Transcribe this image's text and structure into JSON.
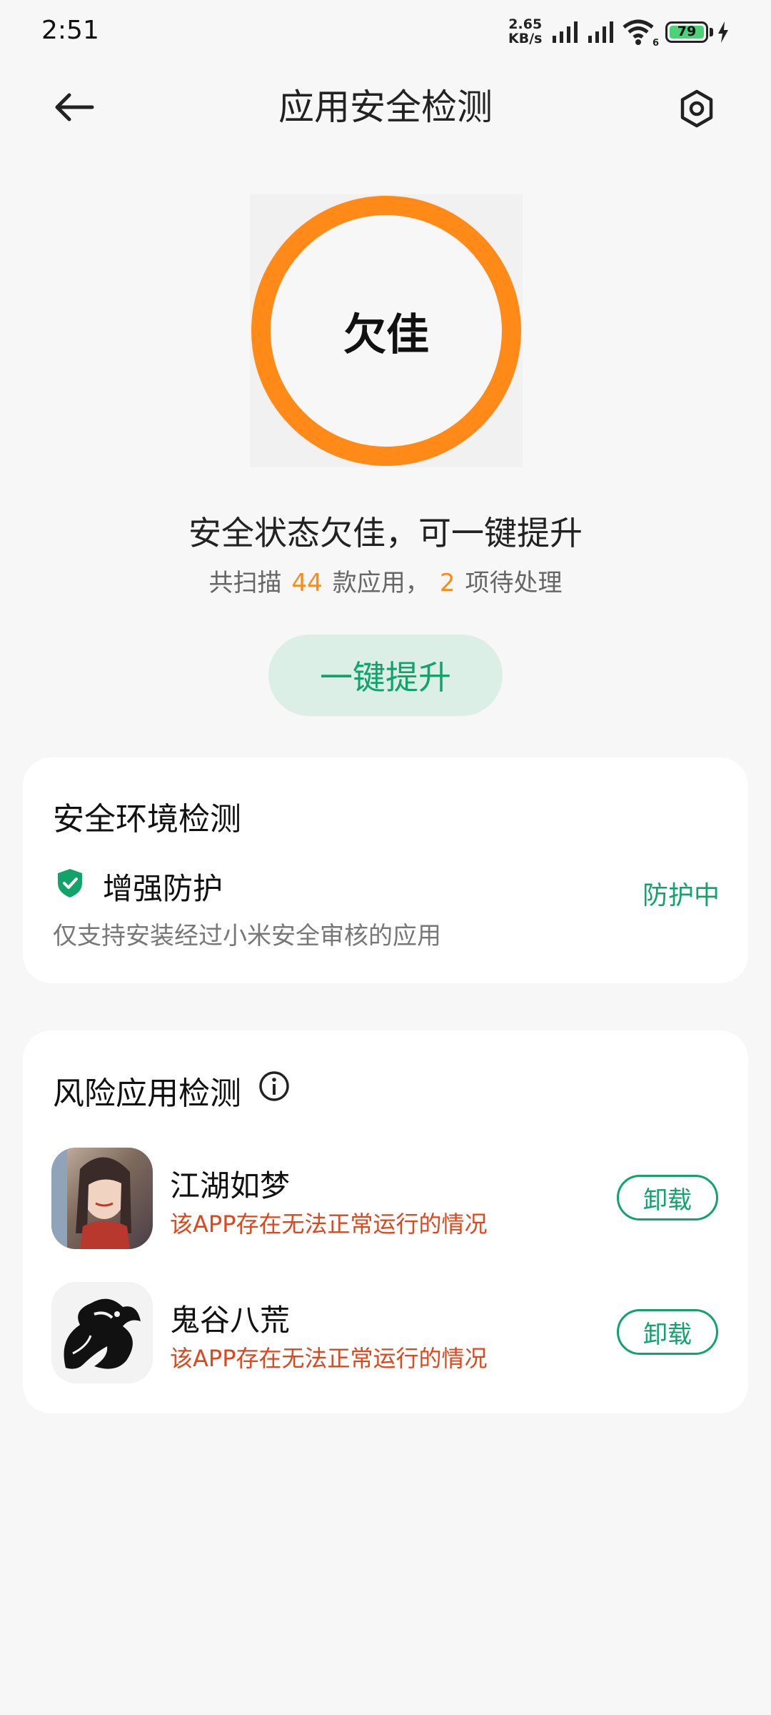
{
  "status_bar": {
    "time": "2:51",
    "net_speed_value": "2.65",
    "net_speed_unit": "KB/s",
    "battery_level": "79",
    "wifi_badge": "6"
  },
  "header": {
    "title": "应用安全检测"
  },
  "summary": {
    "ring_label": "欠佳",
    "ring_color": "#ff8a18",
    "headline": "安全状态欠佳，可一键提升",
    "scan_prefix": "共扫描",
    "scan_count": "44",
    "scan_middle": "款应用，",
    "pending_count": "2",
    "pending_suffix": "项待处理",
    "boost_label": "一键提升"
  },
  "env_check": {
    "title": "安全环境检测",
    "item_label": "增强防护",
    "item_desc": "仅支持安装经过小米安全审核的应用",
    "item_state": "防护中"
  },
  "risk_check": {
    "title": "风险应用检测",
    "apps": [
      {
        "name": "江湖如梦",
        "warning": "该APP存在无法正常运行的情况",
        "action": "卸载"
      },
      {
        "name": "鬼谷八荒",
        "warning": "该APP存在无法正常运行的情况",
        "action": "卸载"
      }
    ]
  },
  "colors": {
    "accent_green": "#12a36b",
    "warning_orange": "#ff8a18",
    "error_red": "#e0461c"
  }
}
